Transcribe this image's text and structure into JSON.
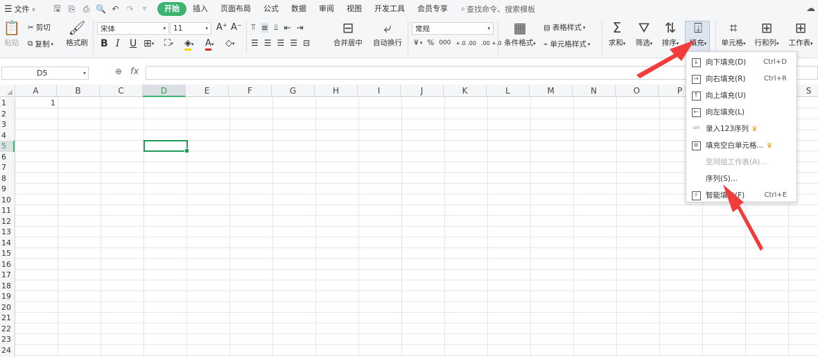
{
  "menubar": {
    "file_label": "文件",
    "tabs": [
      "开始",
      "插入",
      "页面布局",
      "公式",
      "数据",
      "审阅",
      "视图",
      "开发工具",
      "会员专享"
    ],
    "search_placeholder": "查找命令、搜索模板"
  },
  "ribbon": {
    "paste": "粘贴",
    "cut": "剪切",
    "copy": "复制",
    "format_painter": "格式刷",
    "font_name": "宋体",
    "font_size": "11",
    "bold": "B",
    "italic": "I",
    "underline": "U",
    "merge_center": "合并居中",
    "auto_wrap": "自动换行",
    "number_format": "常规",
    "currency": "¥",
    "percent": "%",
    "thousands": "000",
    "dec_inc": "+.0 .00",
    "dec_dec": ".00 +.0",
    "cond_format": "条件格式",
    "table_style": "表格样式",
    "cell_style": "单元格样式",
    "sum": "求和",
    "filter": "筛选",
    "sort": "排序",
    "fill": "填充",
    "cell": "单元格",
    "row_col": "行和列",
    "worksheet": "工作表"
  },
  "formula_bar": {
    "name_box": "D5",
    "fx": "fx",
    "formula": ""
  },
  "grid": {
    "columns": [
      "A",
      "B",
      "C",
      "D",
      "E",
      "F",
      "G",
      "H",
      "I",
      "J",
      "K",
      "L",
      "M",
      "N",
      "O",
      "P",
      "Q",
      "R",
      "S"
    ],
    "rows": [
      "1",
      "2",
      "3",
      "4",
      "5",
      "6",
      "7",
      "8",
      "9",
      "10",
      "11",
      "12",
      "13",
      "14",
      "15",
      "16",
      "17",
      "18",
      "19",
      "20",
      "21",
      "22",
      "23",
      "24"
    ],
    "selected_column": "D",
    "selected_row": "5",
    "cell_A1": "1"
  },
  "fill_menu": {
    "items": [
      {
        "label": "向下填充(D)",
        "shortcut": "Ctrl+D",
        "icon": "fill-down-icon"
      },
      {
        "label": "向右填充(R)",
        "shortcut": "Ctrl+R",
        "icon": "fill-right-icon"
      },
      {
        "label": "向上填充(U)",
        "shortcut": "",
        "icon": "fill-up-icon"
      },
      {
        "label": "向左填充(L)",
        "shortcut": "",
        "icon": "fill-left-icon"
      },
      {
        "label": "录入123序列",
        "shortcut": "",
        "icon": "sequence-123-icon"
      },
      {
        "label": "填充空白单元格...",
        "shortcut": "",
        "icon": "fill-blank-icon"
      },
      {
        "label": "至同组工作表(A)...",
        "shortcut": "",
        "icon": ""
      },
      {
        "label": "序列(S)...",
        "shortcut": "",
        "icon": ""
      },
      {
        "label": "智能填充(F)",
        "shortcut": "Ctrl+E",
        "icon": "smart-fill-icon"
      }
    ]
  },
  "colors": {
    "accent": "#3cb371",
    "arrow": "#f23c3c",
    "selection": "#1f9b58"
  }
}
